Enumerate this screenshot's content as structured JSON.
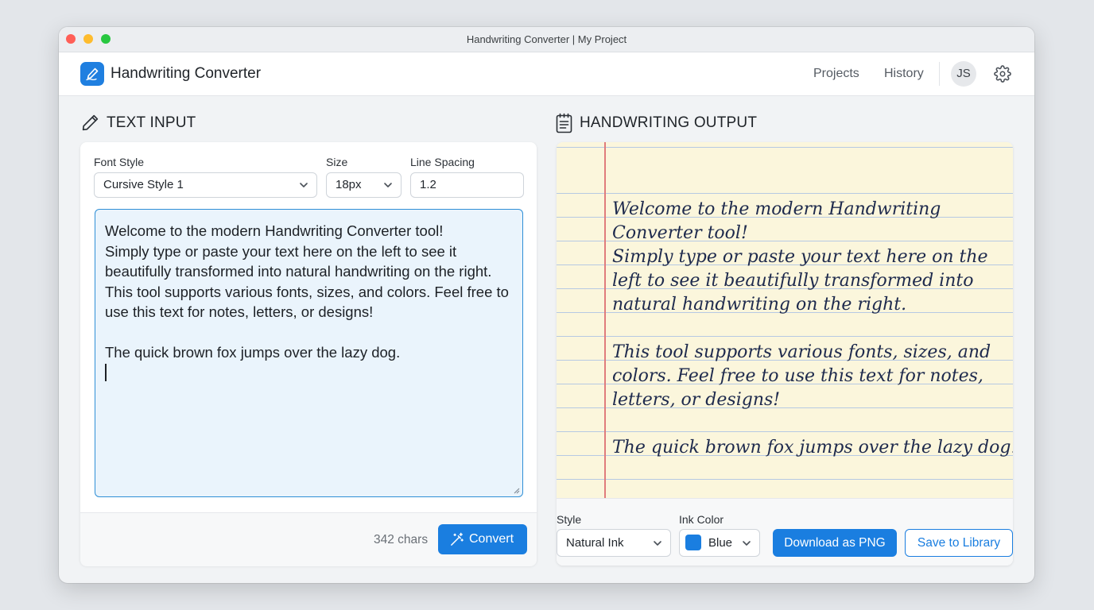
{
  "window": {
    "title": "Handwriting Converter | My Project"
  },
  "appbar": {
    "app_name": "Handwriting Converter",
    "nav": [
      "Projects",
      "History"
    ],
    "avatar_initials": "JS"
  },
  "input_panel": {
    "title": "TEXT INPUT",
    "font_style": {
      "label": "Font Style",
      "value": "Cursive Style 1"
    },
    "size": {
      "label": "Size",
      "value": "18px"
    },
    "line_spacing": {
      "label": "Line Spacing",
      "value": "1.2"
    },
    "text": "Welcome to the modern Handwriting Converter tool!\nSimply type or paste your text here on the left to see it beautifully transformed into natural handwriting on the right. This tool supports various fonts, sizes, and colors. Feel free to use this text for notes, letters, or designs!\n\nThe quick brown fox jumps over the lazy dog.\n",
    "char_count": "342 chars",
    "convert_label": "Convert"
  },
  "output_panel": {
    "title": "HANDWRITING OUTPUT",
    "handwriting_text": "Welcome to the modern Handwriting Converter tool!\nSimply type or paste your text here on the\nleft to see it beautifully transformed into\nnatural handwriting on the right.\n\nThis tool supports various fonts, sizes, and\ncolors. Feel free to use this text for notes,\nletters, or designs!\n\nThe quick brown fox jumps over the lazy dog.",
    "style": {
      "label": "Style",
      "value": "Natural Ink"
    },
    "ink_color": {
      "label": "Ink Color",
      "value": "Blue",
      "swatch": "#1a7ee0"
    },
    "download_label": "Download as PNG",
    "save_label": "Save to Library"
  },
  "colors": {
    "accent": "#1a7ee0",
    "paper": "#fbf6dc",
    "margin": "#e07c7c",
    "rule": "#b6c9e3"
  }
}
